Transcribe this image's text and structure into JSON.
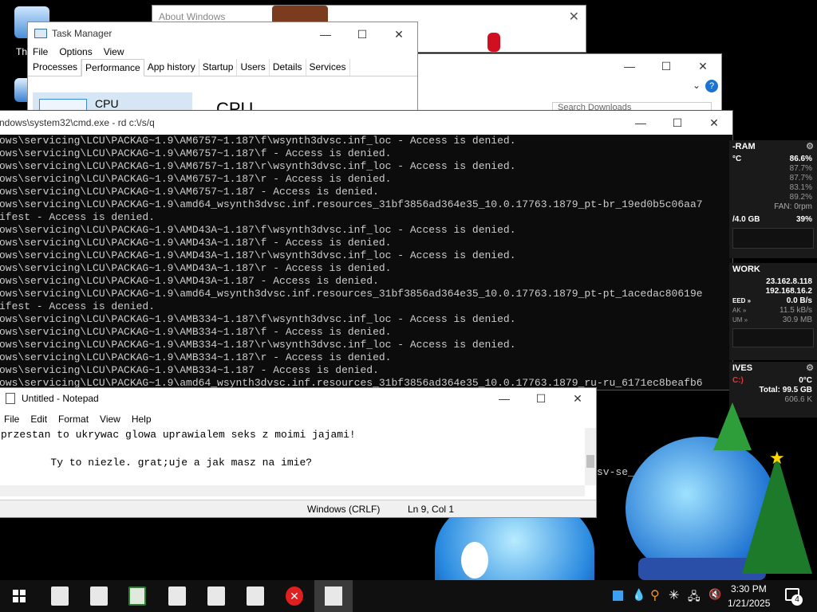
{
  "desktop": {
    "icon1_label": "Th"
  },
  "about": {
    "title": "About Windows"
  },
  "task_manager": {
    "title": "Task Manager",
    "menu": [
      "File",
      "Options",
      "View"
    ],
    "tabs": [
      "Processes",
      "Performance",
      "App history",
      "Startup",
      "Users",
      "Details",
      "Services"
    ],
    "active_tab": "Performance",
    "side_label": "CPU",
    "main_label": "CPU"
  },
  "explorer": {
    "search_placeholder": "Search Downloads"
  },
  "cmd": {
    "title": "ndows\\system32\\cmd.exe - rd  c:\\/s/q",
    "lines": [
      "ows\\servicing\\LCU\\PACKAG~1.9\\AM6757~1.187\\f\\wsynth3dvsc.inf_loc - Access is denied.",
      "ows\\servicing\\LCU\\PACKAG~1.9\\AM6757~1.187\\f - Access is denied.",
      "ows\\servicing\\LCU\\PACKAG~1.9\\AM6757~1.187\\r\\wsynth3dvsc.inf_loc - Access is denied.",
      "ows\\servicing\\LCU\\PACKAG~1.9\\AM6757~1.187\\r - Access is denied.",
      "ows\\servicing\\LCU\\PACKAG~1.9\\AM6757~1.187 - Access is denied.",
      "ows\\servicing\\LCU\\PACKAG~1.9\\amd64_wsynth3dvsc.inf.resources_31bf3856ad364e35_10.0.17763.1879_pt-br_19ed0b5c06aa7",
      "ifest - Access is denied.",
      "ows\\servicing\\LCU\\PACKAG~1.9\\AMD43A~1.187\\f\\wsynth3dvsc.inf_loc - Access is denied.",
      "ows\\servicing\\LCU\\PACKAG~1.9\\AMD43A~1.187\\f - Access is denied.",
      "ows\\servicing\\LCU\\PACKAG~1.9\\AMD43A~1.187\\r\\wsynth3dvsc.inf_loc - Access is denied.",
      "ows\\servicing\\LCU\\PACKAG~1.9\\AMD43A~1.187\\r - Access is denied.",
      "ows\\servicing\\LCU\\PACKAG~1.9\\AMD43A~1.187 - Access is denied.",
      "ows\\servicing\\LCU\\PACKAG~1.9\\amd64_wsynth3dvsc.inf.resources_31bf3856ad364e35_10.0.17763.1879_pt-pt_1acedac80619e",
      "ifest - Access is denied.",
      "ows\\servicing\\LCU\\PACKAG~1.9\\AMB334~1.187\\f\\wsynth3dvsc.inf_loc - Access is denied.",
      "ows\\servicing\\LCU\\PACKAG~1.9\\AMB334~1.187\\f - Access is denied.",
      "ows\\servicing\\LCU\\PACKAG~1.9\\AMB334~1.187\\r\\wsynth3dvsc.inf_loc - Access is denied.",
      "ows\\servicing\\LCU\\PACKAG~1.9\\AMB334~1.187\\r - Access is denied.",
      "ows\\servicing\\LCU\\PACKAG~1.9\\AMB334~1.187 - Access is denied.",
      "ows\\servicing\\LCU\\PACKAG~1.9\\amd64_wsynth3dvsc.inf.resources_31bf3856ad364e35_10.0.17763.1879_ru-ru_6171ec8beafb6"
    ],
    "trailing_fragment": "sv-se_"
  },
  "notepad": {
    "title": "Untitled - Notepad",
    "menu": [
      "File",
      "Edit",
      "Format",
      "View",
      "Help"
    ],
    "line1": "przestan to ukrywac glowa uprawialem seks z moimi jajami!",
    "line2": "        Ty to niezle. grat;uje a jak masz na imie?",
    "encoding": "Windows (CRLF)",
    "position": "Ln 9, Col 1"
  },
  "gadgets": {
    "cpu_ram": {
      "title": "-RAM",
      "temp_label": "°C",
      "cpu_total": "86.6%",
      "cores": [
        "87.7%",
        "87.7%",
        "83.1%",
        "89.2%"
      ],
      "fan": "FAN: 0rpm",
      "ram": "/4.0 GB",
      "ram_pct": "39%"
    },
    "network": {
      "title": "WORK",
      "ip1": "23.162.8.118",
      "ip2": "192.168.16.2",
      "speed_label": "EED »",
      "speed": "0.0 B/s",
      "peak_label": "AK »",
      "peak": "11.5 kB/s",
      "sum_label": "UM »",
      "sum": "30.9 MB"
    },
    "drives": {
      "title": "IVES",
      "drive_label": "C:)",
      "temp": "0°C",
      "total": "Total: 99.5 GB",
      "free": "606.6 K"
    }
  },
  "taskbar": {
    "time": "3:30 PM",
    "date": "1/21/2025",
    "notification_count": "4"
  }
}
